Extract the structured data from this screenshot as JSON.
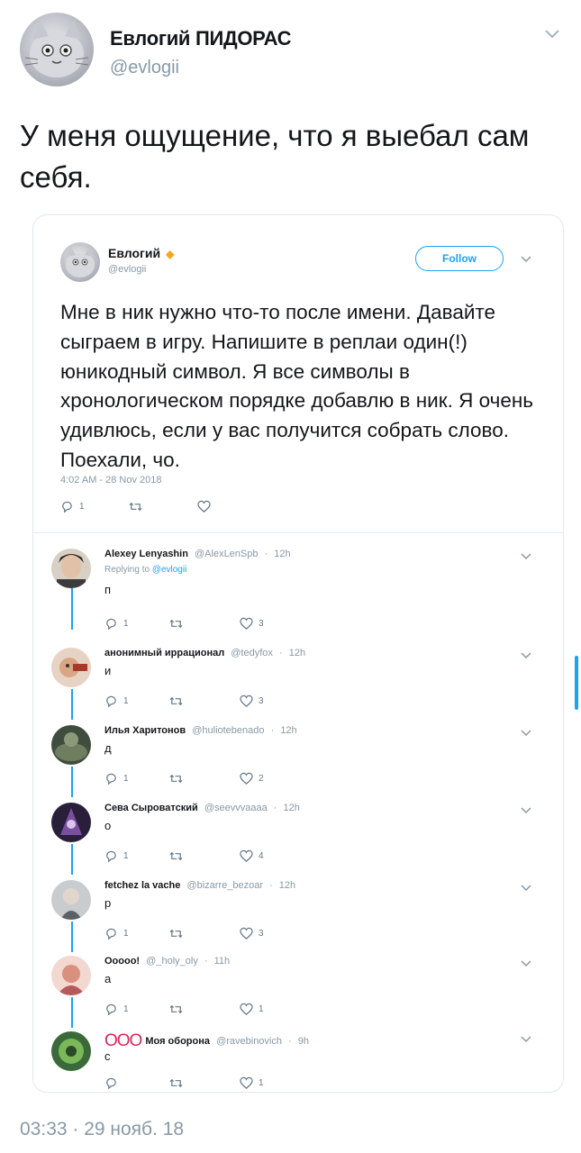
{
  "tweet": {
    "author_name": "Евлогий ПИДОРАС",
    "author_handle": "@evlogii",
    "text": "У меня ощущение, что я выебал сам себя.",
    "timestamp": "03:33 · 29 нояб. 18"
  },
  "quoted": {
    "author_name": "Евлогий",
    "author_handle": "@evlogii",
    "follow_label": "Follow",
    "text": "Мне в ник нужно что-то после имени. Давайте сыграем в игру. Напишите в реплаи один(!) юникодный символ. Я все символы в хронологическом порядке добавлю в ник. Я очень удивлюсь, если у вас получится собрать слово. Поехали, чо.",
    "timestamp": "4:02 AM - 28 Nov 2018",
    "reply_count": "1",
    "retweet_count": "",
    "like_count": ""
  },
  "replies": [
    {
      "name": "Alexey Lenyashin",
      "handle": "@AlexLenSpb",
      "time": "12h",
      "replying_label": "Replying to",
      "replying_to": "@evlogii",
      "text": "п",
      "reply_count": "1",
      "like_count": "3",
      "avatar_color": "#6b5a4e"
    },
    {
      "name": "анонимный иррационал",
      "handle": "@tedyfox",
      "time": "12h",
      "text": "и",
      "reply_count": "1",
      "like_count": "3",
      "avatar_color": "#c9a48a"
    },
    {
      "name": "Илья Харитонов",
      "handle": "@huliotebenado",
      "time": "12h",
      "text": "д",
      "reply_count": "1",
      "like_count": "2",
      "avatar_color": "#4a5a48"
    },
    {
      "name": "Сева Сыроватский",
      "handle": "@seevvvaaaa",
      "time": "12h",
      "text": "о",
      "reply_count": "1",
      "like_count": "4",
      "avatar_color": "#5a3a6e"
    },
    {
      "name": "fetchez la vache",
      "handle": "@bizarre_bezoar",
      "time": "12h",
      "text": "р",
      "reply_count": "1",
      "like_count": "3",
      "avatar_color": "#8b8e94"
    },
    {
      "name": "Ooooo!",
      "handle": "@_holy_oly",
      "time": "11h",
      "text": "а",
      "reply_count": "1",
      "like_count": "1",
      "avatar_color": "#c98a86"
    },
    {
      "name_prefix": "ООО",
      "name": "Моя оборона",
      "handle": "@ravebinovich",
      "time": "9h",
      "text": "с",
      "reply_count": "",
      "like_count": "1",
      "avatar_color": "#5a8a4a"
    }
  ]
}
